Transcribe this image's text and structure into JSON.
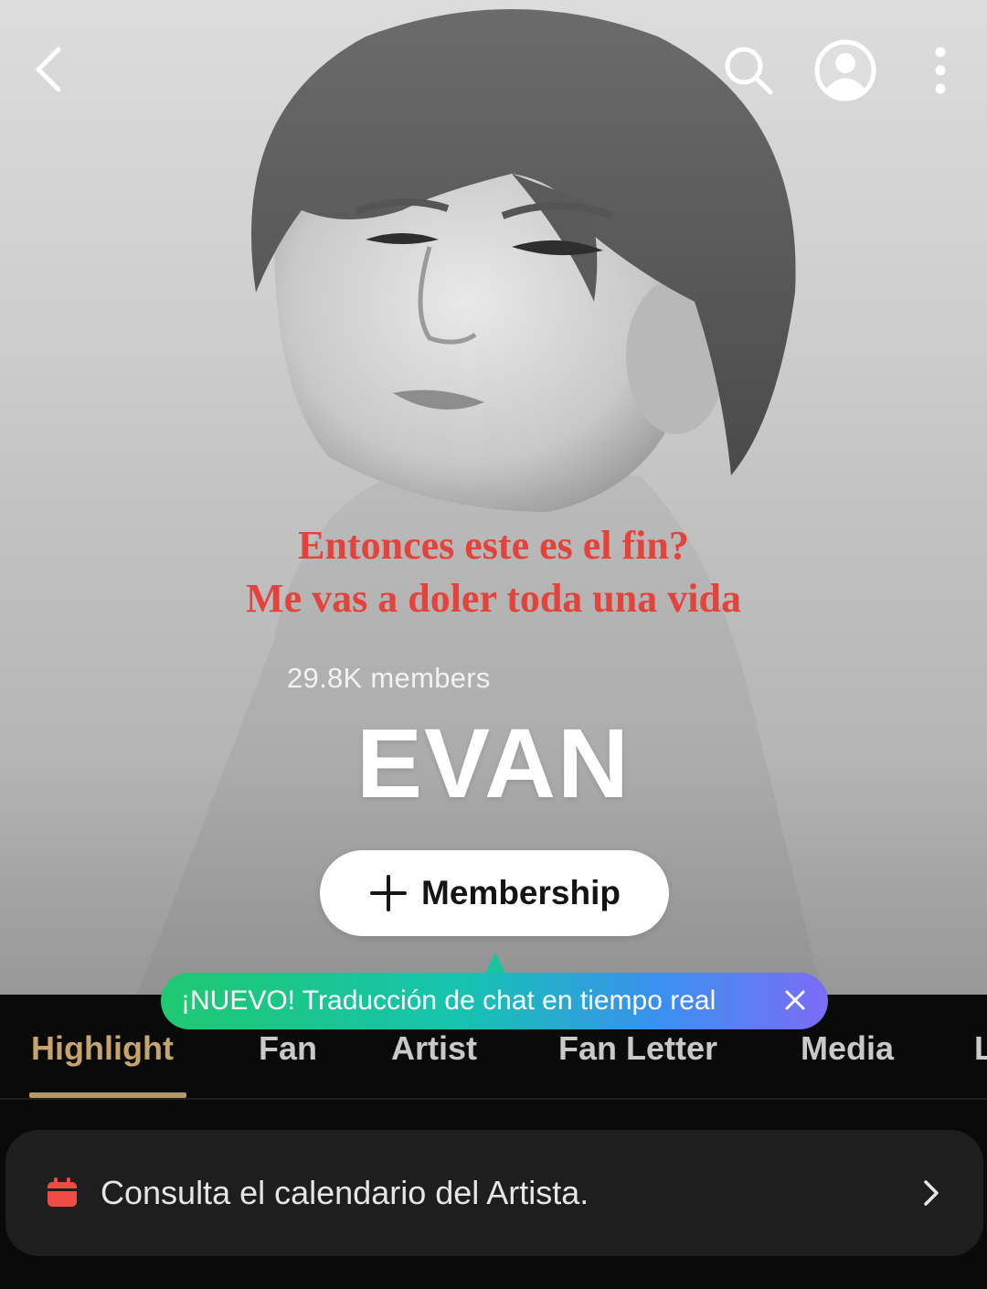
{
  "header": {
    "back_icon": "back-chevron-icon",
    "search_icon": "search-icon",
    "profile_icon": "profile-avatar-icon",
    "more_icon": "more-vertical-icon"
  },
  "overlay_caption": {
    "line1": "Entonces este es el fin?",
    "line2": "Me vas a doler toda una vida",
    "color": "#e4433c"
  },
  "community": {
    "members": "29.8K members",
    "artist_name": "EVAN",
    "membership_button": "Membership"
  },
  "tooltip": {
    "text": "¡NUEVO! Traducción de chat en tiempo real",
    "close_icon": "close-icon"
  },
  "tabs": [
    {
      "label": "Highlight",
      "active": true
    },
    {
      "label": "Fan",
      "active": false
    },
    {
      "label": "Artist",
      "active": false
    },
    {
      "label": "Fan Letter",
      "active": false
    },
    {
      "label": "Media",
      "active": false
    },
    {
      "label": "L",
      "active": false
    }
  ],
  "calendar_card": {
    "text": "Consulta el calendario del Artista.",
    "icon": "calendar-icon",
    "icon_color": "#ef4b45",
    "chevron_icon": "chevron-right-icon"
  },
  "colors": {
    "accent_tab": "#c5a46d",
    "background": "#0a0a0a",
    "card": "#1e1e1e"
  }
}
